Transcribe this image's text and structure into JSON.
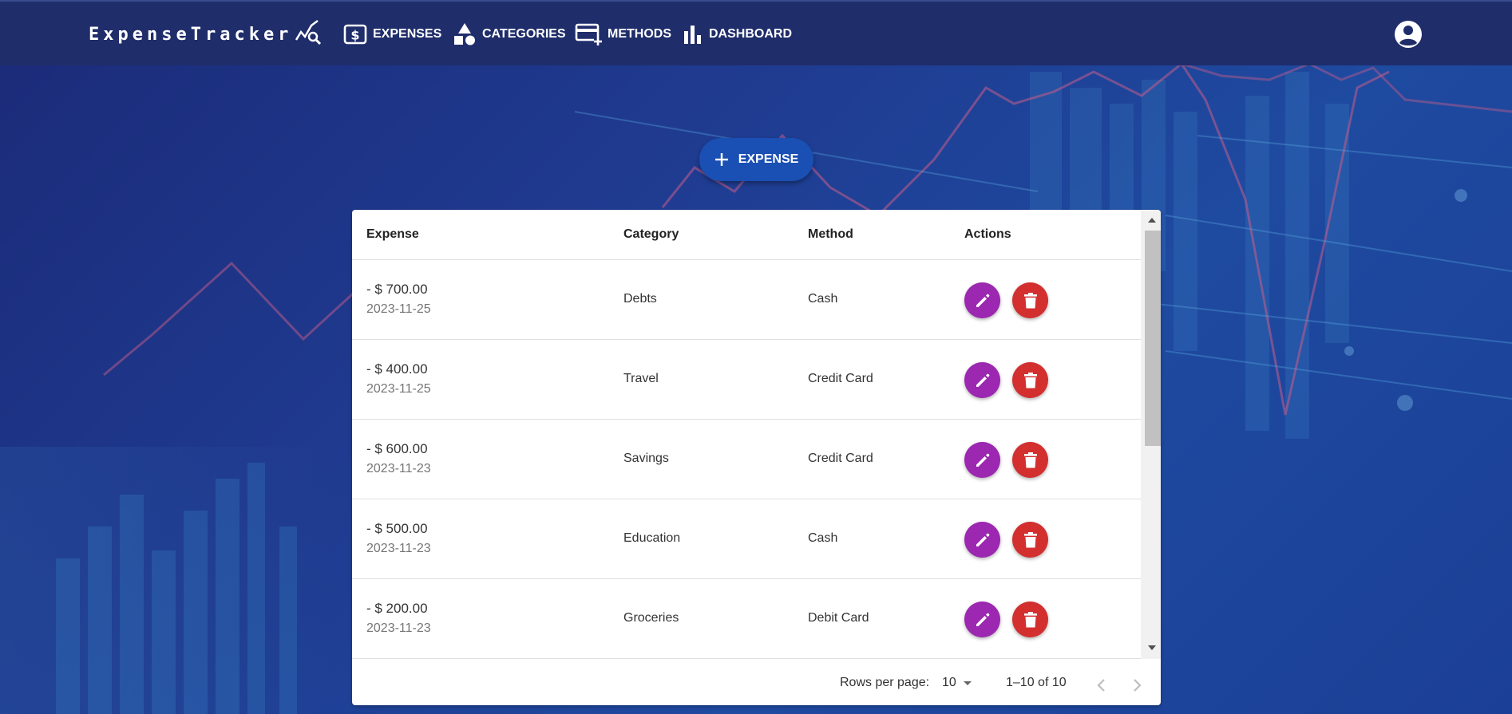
{
  "app": {
    "brand": "ExpenseTracker",
    "brand_logo_icon": "chart-search-icon"
  },
  "nav": {
    "items": [
      {
        "label": "EXPENSES",
        "icon": "dollar-box-icon"
      },
      {
        "label": "CATEGORIES",
        "icon": "shapes-icon"
      },
      {
        "label": "METHODS",
        "icon": "credit-card-plus-icon"
      },
      {
        "label": "DASHBOARD",
        "icon": "bar-chart-icon"
      }
    ],
    "account_icon": "account-circle-icon"
  },
  "actions": {
    "add_expense_label": "EXPENSE",
    "add_icon": "plus-icon"
  },
  "table": {
    "headers": {
      "expense": "Expense",
      "category": "Category",
      "method": "Method",
      "actions": "Actions"
    },
    "rows": [
      {
        "amount": "- $ 700.00",
        "date": "2023-11-25",
        "category": "Debts",
        "method": "Cash"
      },
      {
        "amount": "- $ 400.00",
        "date": "2023-11-25",
        "category": "Travel",
        "method": "Credit Card"
      },
      {
        "amount": "- $ 600.00",
        "date": "2023-11-23",
        "category": "Savings",
        "method": "Credit Card"
      },
      {
        "amount": "- $ 500.00",
        "date": "2023-11-23",
        "category": "Education",
        "method": "Cash"
      },
      {
        "amount": "- $ 200.00",
        "date": "2023-11-23",
        "category": "Groceries",
        "method": "Debit Card"
      }
    ],
    "row_actions": {
      "edit_icon": "pencil-icon",
      "delete_icon": "trash-icon"
    }
  },
  "pagination": {
    "rows_per_page_label": "Rows per page:",
    "rows_per_page_value": "10",
    "range": "1–10 of 10"
  },
  "colors": {
    "topbar": "#1f2d6b",
    "background": "#1e3a8f",
    "primary_button": "#1a4fb3",
    "edit_button": "#9c27b0",
    "delete_button": "#d32f2f"
  }
}
